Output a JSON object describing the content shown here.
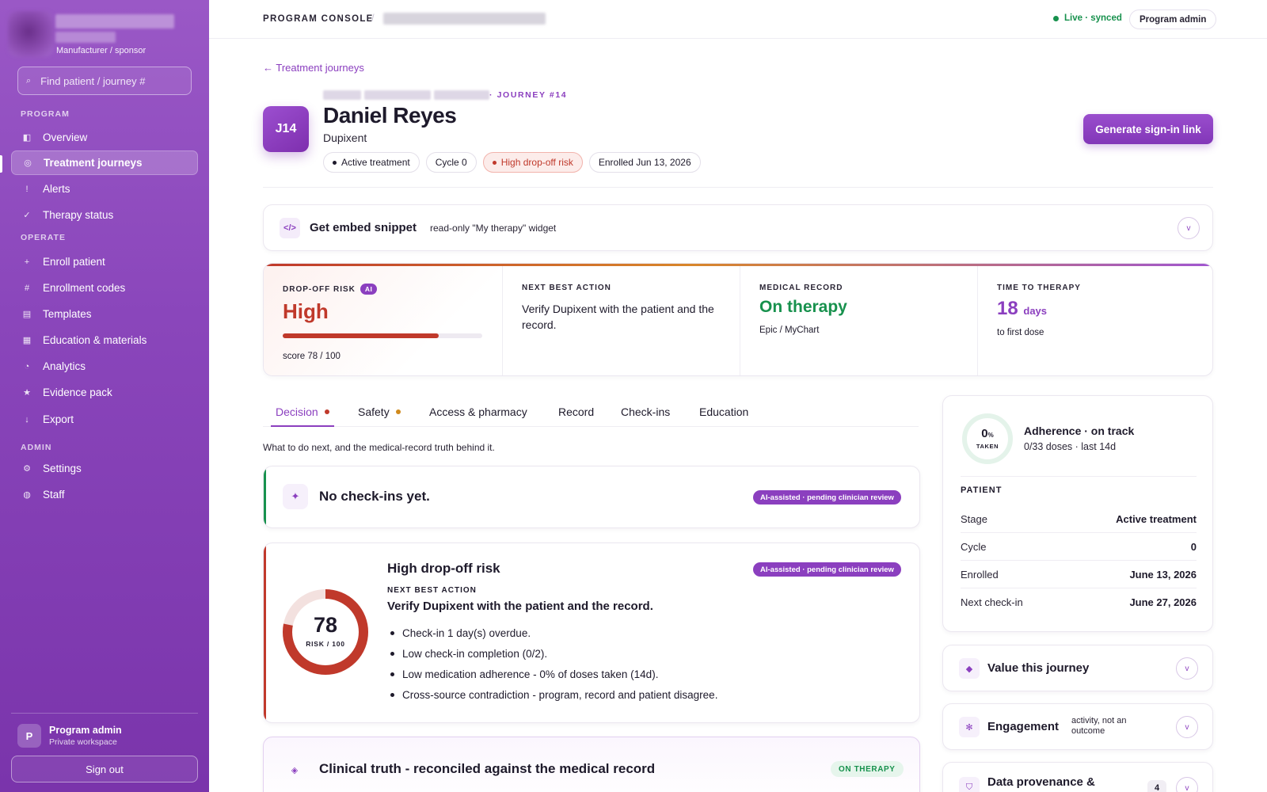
{
  "sidebar": {
    "org_role": "Manufacturer / sponsor",
    "search_placeholder": "Find patient / journey #",
    "sections": {
      "program": "PROGRAM",
      "operate": "OPERATE",
      "admin": "ADMIN"
    },
    "items": [
      {
        "label": "Overview",
        "icon": "overview-icon"
      },
      {
        "label": "Treatment journeys",
        "icon": "journey-icon",
        "active": true
      },
      {
        "label": "Alerts",
        "icon": "alert-icon"
      },
      {
        "label": "Therapy status",
        "icon": "check-icon"
      },
      {
        "label": "Enroll patient",
        "icon": "plus-icon"
      },
      {
        "label": "Enrollment codes",
        "icon": "hash-icon"
      },
      {
        "label": "Templates",
        "icon": "template-icon"
      },
      {
        "label": "Education & materials",
        "icon": "book-icon"
      },
      {
        "label": "Analytics",
        "icon": "pie-icon"
      },
      {
        "label": "Evidence pack",
        "icon": "star-icon"
      },
      {
        "label": "Export",
        "icon": "download-icon"
      },
      {
        "label": "Settings",
        "icon": "gear-icon"
      },
      {
        "label": "Staff",
        "icon": "staff-icon"
      }
    ],
    "user": {
      "initial": "P",
      "name": "Program admin",
      "workspace": "Private workspace"
    },
    "sign_out": "Sign out"
  },
  "topbar": {
    "console": "PROGRAM CONSOLE",
    "separator": "/",
    "status": "Live · synced",
    "role": "Program admin"
  },
  "header": {
    "back": "← Treatment journeys",
    "journey_tag": "· JOURNEY #14",
    "badge": "J14",
    "patient_name": "Daniel Reyes",
    "drug": "Dupixent",
    "chips": [
      "Active treatment",
      "Cycle 0",
      "High drop-off risk",
      "Enrolled Jun 13, 2026"
    ],
    "generate_button": "Generate sign-in link"
  },
  "embed": {
    "icon": "</>",
    "title": "Get embed snippet",
    "subtitle": "read-only \"My therapy\" widget",
    "chevron": "v"
  },
  "stats": {
    "risk": {
      "label": "DROP-OFF RISK",
      "ai": "AI",
      "value": "High",
      "score_text": "score 78 / 100",
      "score": 78,
      "max": 100
    },
    "next_action": {
      "label": "NEXT BEST ACTION",
      "text": "Verify Dupixent with the patient and the record."
    },
    "medical_record": {
      "label": "MEDICAL RECORD",
      "value": "On therapy",
      "source": "Epic / MyChart"
    },
    "time_to_therapy": {
      "label": "TIME TO THERAPY",
      "value": "18",
      "unit": "days",
      "sub": "to first dose"
    }
  },
  "tabs": [
    {
      "label": "Decision",
      "dot": "#c0392b"
    },
    {
      "label": "Safety",
      "dot": "#d08a1c"
    },
    {
      "label": "Access & pharmacy"
    },
    {
      "label": "Record"
    },
    {
      "label": "Check-ins"
    },
    {
      "label": "Education"
    }
  ],
  "tab_caption": "What to do next, and the medical-record truth behind it.",
  "checkin_card": {
    "icon": "✦",
    "title": "No check-ins yet.",
    "ai_tag": "AI-assisted · pending clinician review"
  },
  "risk_card": {
    "score": "78",
    "score_value": 78,
    "score_label": "RISK / 100",
    "title": "High drop-off risk",
    "ai_tag": "AI-assisted · pending clinician review",
    "nba_label": "NEXT BEST ACTION",
    "nba": "Verify Dupixent with the patient and the record.",
    "reasons": [
      "Check-in 1 day(s) overdue.",
      "Low check-in completion (0/2).",
      "Low medication adherence - 0% of doses taken (14d).",
      "Cross-source contradiction - program, record and patient disagree."
    ]
  },
  "clinical_truth": {
    "icon": "◈",
    "title": "Clinical truth - reconciled against the medical record",
    "badge": "ON THERAPY"
  },
  "adherence": {
    "value": "0",
    "unit": "%",
    "taken_label": "TAKEN",
    "title": "Adherence · on track",
    "sub": "0/33 doses · last 14d",
    "patient_label": "PATIENT",
    "rows": [
      {
        "key": "Stage",
        "value": "Active treatment"
      },
      {
        "key": "Cycle",
        "value": "0"
      },
      {
        "key": "Enrolled",
        "value": "June 13, 2026"
      },
      {
        "key": "Next check-in",
        "value": "June 27, 2026"
      }
    ]
  },
  "value_journey": {
    "icon": "◆",
    "title": "Value this journey",
    "chevron": "v"
  },
  "engagement": {
    "icon": "✻",
    "title": "Engagement",
    "sub": "activity, not an outcome",
    "chevron": "v"
  },
  "data_provenance": {
    "icon": "⛉",
    "title": "Data provenance &",
    "count": "4",
    "chevron": "v"
  },
  "colors": {
    "brand": "#8b3fbf",
    "danger": "#c0392b",
    "success": "#17914d",
    "warning": "#d08a1c"
  }
}
